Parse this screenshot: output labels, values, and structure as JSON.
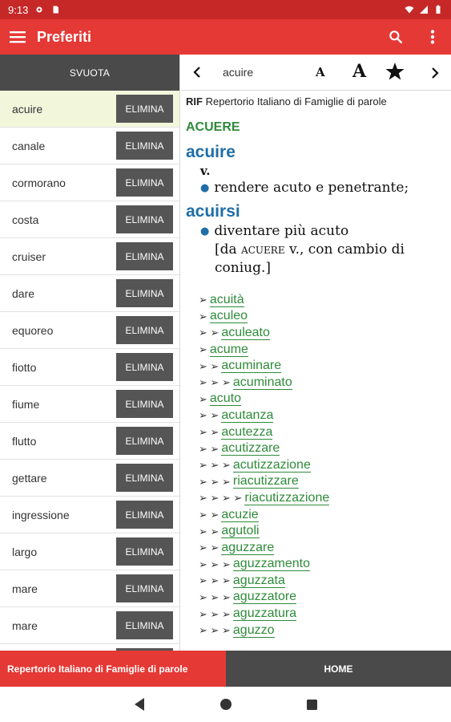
{
  "status_bar": {
    "time": "9:13",
    "icons": [
      "settings-icon",
      "sd-card-icon",
      "wifi-icon",
      "signal-icon",
      "battery-icon"
    ]
  },
  "app_bar": {
    "title": "Preferiti",
    "icons": [
      "menu-icon",
      "search-icon",
      "more-vert-icon"
    ]
  },
  "favorites": {
    "clear_label": "SVUOTA",
    "delete_label": "ELIMINA",
    "items": [
      {
        "word": "acuire"
      },
      {
        "word": "canale"
      },
      {
        "word": "cormorano"
      },
      {
        "word": "costa"
      },
      {
        "word": "cruiser"
      },
      {
        "word": "dare"
      },
      {
        "word": "equoreo"
      },
      {
        "word": "fiotto"
      },
      {
        "word": "fiume"
      },
      {
        "word": "flutto"
      },
      {
        "word": "gettare"
      },
      {
        "word": "ingressione"
      },
      {
        "word": "largo"
      },
      {
        "word": "mare"
      },
      {
        "word": "mare"
      },
      {
        "word": ""
      }
    ]
  },
  "detail": {
    "toolbar": {
      "word": "acuire",
      "font_small": "A",
      "font_large": "A"
    },
    "source_code": "RIF",
    "source_name": "Repertorio Italiano di Famiglie di parole",
    "family_head": "ACUERE",
    "lemma1": "acuire",
    "pos1": "v.",
    "def1": "rendere acuto e penetrante;",
    "lemma2": "acuirsi",
    "def2": "diventare più acuto",
    "etym_open": "[da ",
    "etym_word": "acuere",
    "etym_rest": " v., con cambio di",
    "etym_line2": "coniug.]",
    "derived": [
      {
        "arrows": "➢",
        "word": "acuità"
      },
      {
        "arrows": "➢",
        "word": "aculeo"
      },
      {
        "arrows": "➢ ➢",
        "word": "aculeato"
      },
      {
        "arrows": "➢",
        "word": "acume"
      },
      {
        "arrows": "➢ ➢",
        "word": "acuminare"
      },
      {
        "arrows": "➢ ➢ ➢",
        "word": "acuminato"
      },
      {
        "arrows": "➢",
        "word": "acuto"
      },
      {
        "arrows": "➢ ➢",
        "word": "acutanza"
      },
      {
        "arrows": "➢ ➢",
        "word": "acutezza"
      },
      {
        "arrows": "➢ ➢",
        "word": "acutizzare"
      },
      {
        "arrows": "➢ ➢ ➢",
        "word": "acutizzazione"
      },
      {
        "arrows": "➢ ➢ ➢",
        "word": "riacutizzare"
      },
      {
        "arrows": "➢ ➢ ➢ ➢",
        "word": "riacutizzazione"
      },
      {
        "arrows": "➢ ➢",
        "word": "acuzie"
      },
      {
        "arrows": "➢ ➢",
        "word": "agutoli"
      },
      {
        "arrows": "➢ ➢",
        "word": "aguzzare"
      },
      {
        "arrows": "➢ ➢ ➢",
        "word": "aguzzamento"
      },
      {
        "arrows": "➢ ➢ ➢",
        "word": "aguzzata"
      },
      {
        "arrows": "➢ ➢ ➢",
        "word": "aguzzatore"
      },
      {
        "arrows": "➢ ➢ ➢",
        "word": "aguzzatura"
      },
      {
        "arrows": "➢ ➢ ➢",
        "word": "aguzzo"
      }
    ]
  },
  "bottom_bar": {
    "source_label": "Repertorio Italiano di Famiglie di parole",
    "home_label": "HOME"
  },
  "nav_bar": {
    "icons": [
      "back-icon",
      "home-icon",
      "recents-icon"
    ]
  },
  "colors": {
    "accent": "#e53935",
    "status_bar": "#c62828",
    "dark_button": "#555555",
    "link_green": "#2e8b3a",
    "lemma_blue": "#1f6ea8",
    "selected_row": "#f2f7dc"
  }
}
